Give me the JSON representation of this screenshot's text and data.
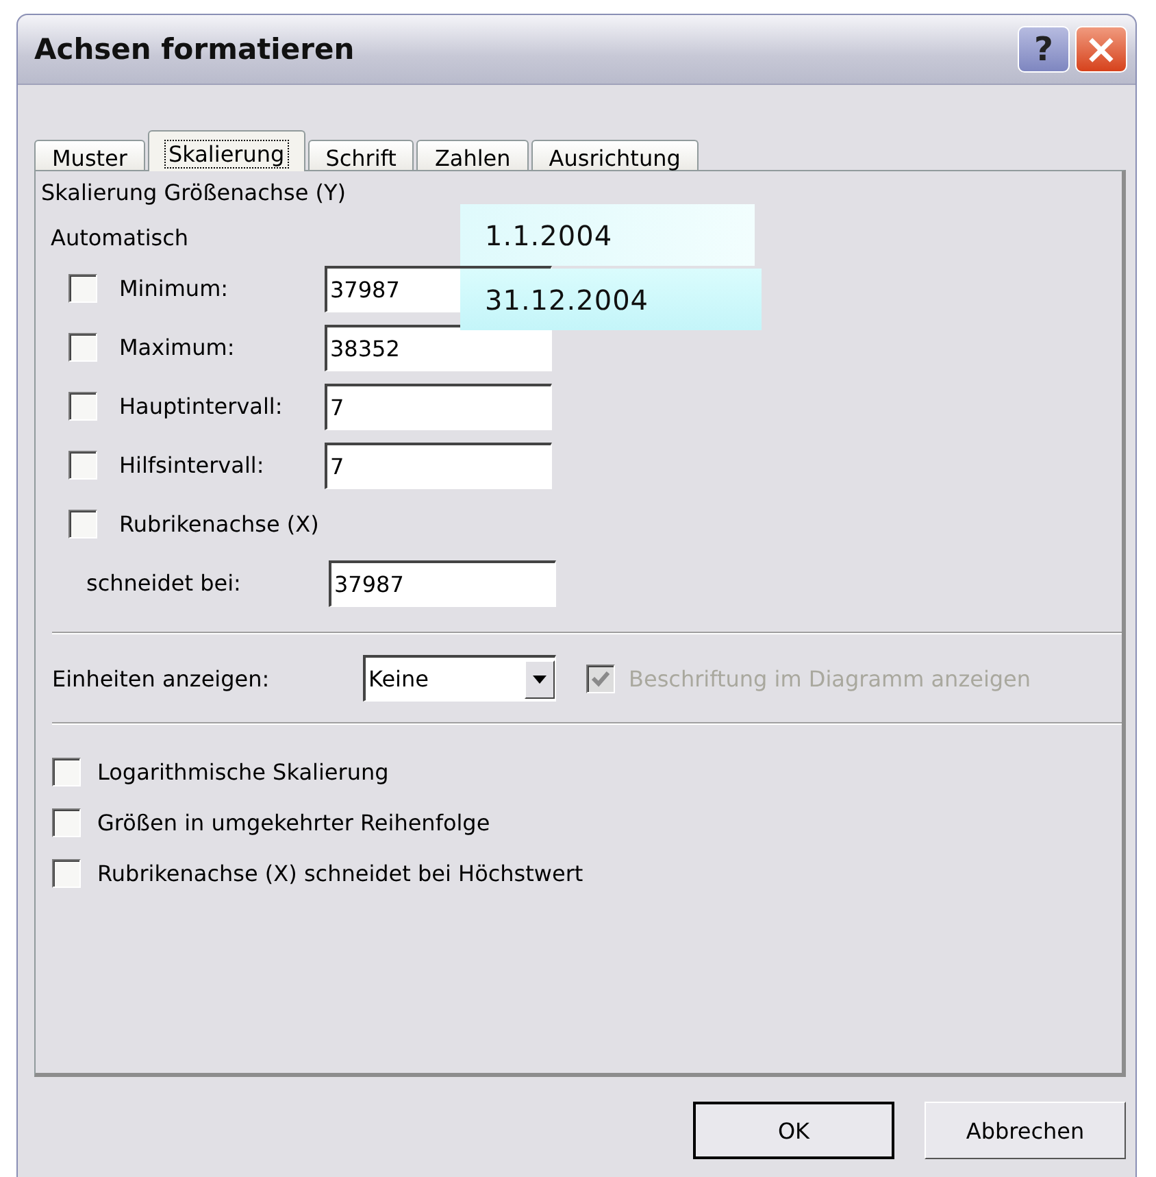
{
  "window": {
    "title": "Achsen formatieren"
  },
  "title_buttons": [
    {
      "kind": "help",
      "label": "?"
    },
    {
      "kind": "close",
      "label": "×"
    }
  ],
  "tabs": [
    {
      "label": "Muster",
      "selected": false
    },
    {
      "label": "Skalierung",
      "selected": true
    },
    {
      "label": "Schrift",
      "selected": false
    },
    {
      "label": "Zahlen",
      "selected": false
    },
    {
      "label": "Ausrichtung",
      "selected": false
    }
  ],
  "section_title": "Skalierung Größenachse (Y)",
  "auto_heading": "Automatisch",
  "fields": [
    {
      "label": "Minimum:",
      "value": "37987",
      "checked": false,
      "kind": "check"
    },
    {
      "label": "Maximum:",
      "value": "38352",
      "checked": false,
      "kind": "check"
    },
    {
      "label": "Hauptintervall:",
      "value": "7",
      "checked": false,
      "kind": "check"
    },
    {
      "label": "Hilfsintervall:",
      "value": "7",
      "checked": false,
      "kind": "check"
    },
    {
      "label": "Rubrikenachse (X)",
      "checked": false,
      "kind": "check_only"
    },
    {
      "label": "schneidet bei:",
      "value": "37987",
      "kind": "field_only"
    }
  ],
  "units": {
    "label": "Einheiten anzeigen:",
    "value": "Keine",
    "show_label": {
      "label": "Beschriftung im Diagramm anzeigen",
      "checked": true,
      "disabled": true
    }
  },
  "options": [
    {
      "label": "Logarithmische Skalierung",
      "checked": false
    },
    {
      "label": "Größen in umgekehrter Reihenfolge",
      "checked": false
    },
    {
      "label": "Rubrikenachse (X) schneidet bei Höchstwert",
      "checked": false
    }
  ],
  "buttons": [
    {
      "label": "OK",
      "selected": true
    },
    {
      "label": "Abbrechen",
      "selected": false
    }
  ],
  "annotations": [
    "1.1.2004",
    "31.12.2004"
  ]
}
